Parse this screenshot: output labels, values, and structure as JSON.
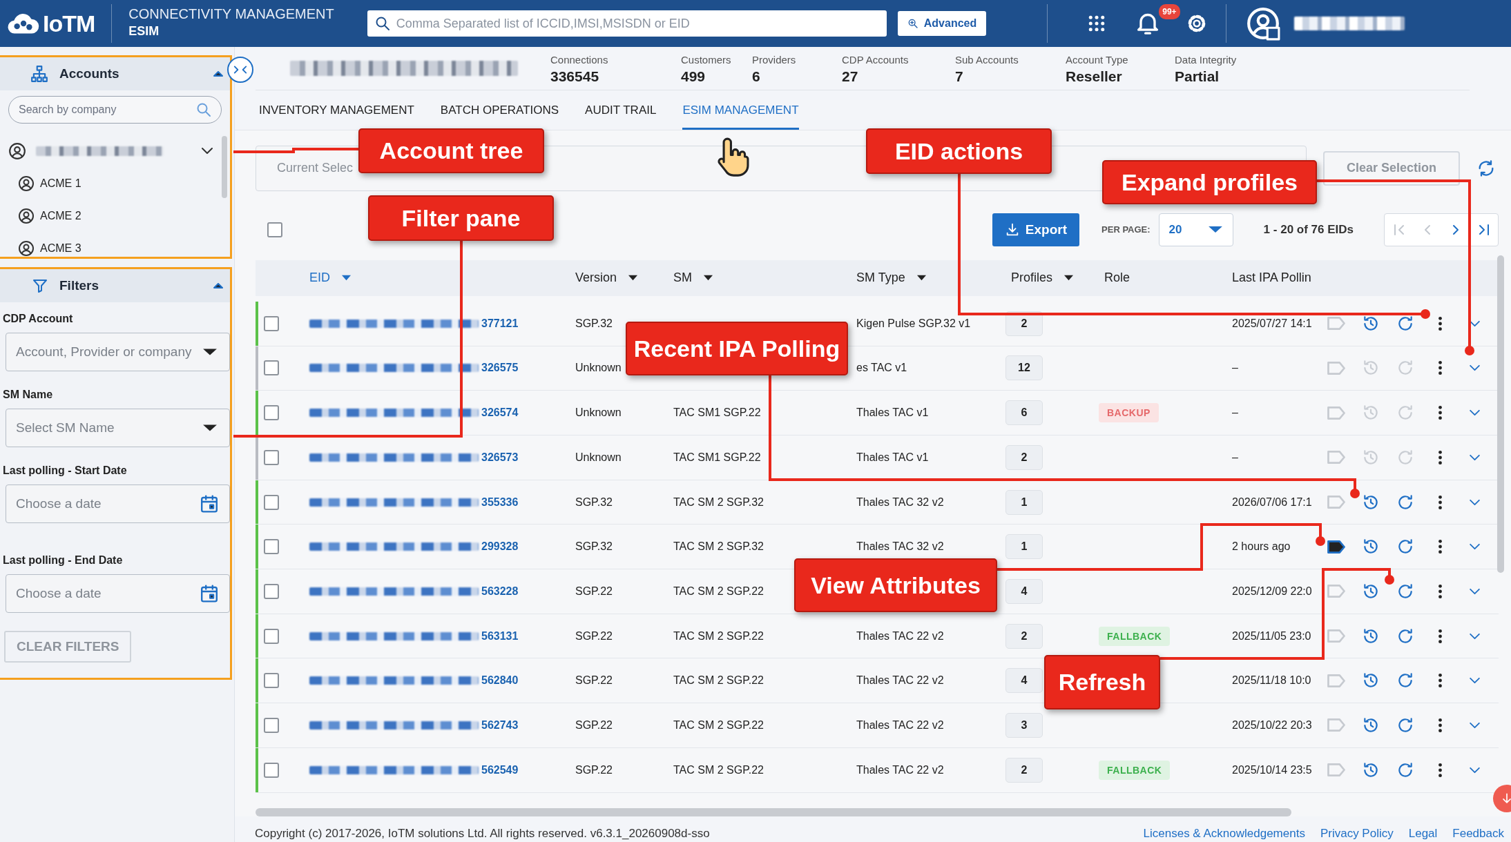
{
  "header": {
    "logo": "IoTM",
    "title": "CONNECTIVITY MANAGEMENT",
    "subtitle": "ESIM",
    "search": {
      "placeholder": "Comma Separated list of ICCID,IMSI,MSISDN or EID"
    },
    "advanced_button": "Advanced",
    "notifications_badge": "99+"
  },
  "sidebar": {
    "accounts": {
      "title": "Accounts",
      "expanded": true,
      "search": {
        "placeholder": "Search by company"
      },
      "root_expanded": true,
      "items": [
        {
          "label": "ACME 1"
        },
        {
          "label": "ACME 2"
        },
        {
          "label": "ACME 3"
        }
      ]
    },
    "filters": {
      "title": "Filters",
      "expanded": true,
      "fields": [
        {
          "label": "CDP Account",
          "placeholder": "Account, Provider or company",
          "kind": "select"
        },
        {
          "label": "SM Name",
          "placeholder": "Select SM Name",
          "kind": "select"
        },
        {
          "label": "Last polling - Start Date",
          "placeholder": "Choose a date",
          "kind": "date"
        },
        {
          "label": "Last polling - End Date",
          "placeholder": "Choose a date",
          "kind": "date"
        }
      ],
      "clear_button": {
        "label": "CLEAR FILTERS",
        "disabled": true
      }
    }
  },
  "stats": [
    {
      "label": "Connections",
      "value": "336545"
    },
    {
      "label": "Customers",
      "value": "499"
    },
    {
      "label": "Providers",
      "value": "6"
    },
    {
      "label": "CDP Accounts",
      "value": "27"
    },
    {
      "label": "Sub Accounts",
      "value": "7"
    },
    {
      "label": "Account Type",
      "value": "Reseller"
    },
    {
      "label": "Data Integrity",
      "value": "Partial"
    }
  ],
  "tabs": [
    {
      "label": "INVENTORY MANAGEMENT",
      "selected": false
    },
    {
      "label": "BATCH OPERATIONS",
      "selected": false
    },
    {
      "label": "AUDIT TRAIL",
      "selected": false
    },
    {
      "label": "ESIM MANAGEMENT",
      "selected": true
    }
  ],
  "selection": {
    "placeholder": "Current Selec",
    "clear_button": {
      "label": "Clear Selection",
      "disabled": true
    }
  },
  "toolbar": {
    "select_all_checked": false,
    "export_button": "Export",
    "per_page_label": "PER PAGE:",
    "per_page": "20",
    "range": "1 - 20 of 76 EIDs",
    "pager": [
      {
        "kind": "first",
        "disabled": true
      },
      {
        "kind": "prev",
        "disabled": true
      },
      {
        "kind": "next",
        "disabled": false
      },
      {
        "kind": "last",
        "disabled": false
      }
    ]
  },
  "table": {
    "columns": [
      {
        "label": "EID",
        "sortable": true,
        "sorted": true
      },
      {
        "label": "Version",
        "sortable": true,
        "sorted": false
      },
      {
        "label": "SM",
        "sortable": true,
        "sorted": false
      },
      {
        "label": "SM Type",
        "sortable": true,
        "sorted": false
      },
      {
        "label": "Profiles",
        "sortable": true,
        "sorted": false
      },
      {
        "label": "Role",
        "sortable": false,
        "sorted": false
      },
      {
        "label": "Last IPA Pollin",
        "sortable": false,
        "sorted": false
      }
    ],
    "rows": [
      {
        "eid": "377121",
        "checked": false,
        "version": "SGP.32",
        "sm_type": "Kigen Pulse SGP.32 v1",
        "profiles": "2",
        "last_ipa": "2025/07/27 14:1",
        "color": "#5cc24a",
        "attributes": false,
        "actions_enabled": true
      },
      {
        "eid": "326575",
        "checked": false,
        "version": "Unknown",
        "sm_type": "es TAC v1",
        "profiles": "12",
        "last_ipa": "–",
        "color": "#b9bcc2",
        "attributes": false,
        "actions_enabled": false
      },
      {
        "eid": "326574",
        "checked": false,
        "version": "Unknown",
        "sm": "TAC SM1 SGP.22",
        "sm_type": "Thales TAC v1",
        "profiles": "6",
        "role": {
          "kind": "backup",
          "label": "BACKUP"
        },
        "last_ipa": "–",
        "color": "#5cc24a",
        "attributes": false,
        "actions_enabled": false
      },
      {
        "eid": "326573",
        "checked": false,
        "version": "Unknown",
        "sm": "TAC SM1 SGP.22",
        "sm_type": "Thales TAC v1",
        "profiles": "2",
        "last_ipa": "–",
        "color": "#b9bcc2",
        "attributes": false,
        "actions_enabled": false
      },
      {
        "eid": "355336",
        "checked": false,
        "version": "SGP.32",
        "sm": "TAC SM 2 SGP.32",
        "sm_type": "Thales TAC 32 v2",
        "profiles": "1",
        "last_ipa": "2026/07/06 17:1",
        "color": "#5cc24a",
        "attributes": false,
        "actions_enabled": true
      },
      {
        "eid": "299328",
        "checked": false,
        "version": "SGP.32",
        "sm": "TAC SM 2 SGP.32",
        "sm_type": "Thales TAC 32 v2",
        "profiles": "1",
        "last_ipa": "2 hours ago",
        "color": "#5cc24a",
        "attributes": true,
        "actions_enabled": true
      },
      {
        "eid": "563228",
        "checked": false,
        "version": "SGP.22",
        "sm": "TAC SM 2 SGP.22",
        "profiles": "4",
        "last_ipa": "2025/12/09 22:0",
        "color": "#5cc24a",
        "attributes": false,
        "actions_enabled": true
      },
      {
        "eid": "563131",
        "checked": false,
        "version": "SGP.22",
        "sm": "TAC SM 2 SGP.22",
        "sm_type": "Thales TAC 22 v2",
        "profiles": "2",
        "role": {
          "kind": "fallback",
          "label": "FALLBACK"
        },
        "last_ipa": "2025/11/05 23:0",
        "color": "#5cc24a",
        "attributes": false,
        "actions_enabled": true
      },
      {
        "eid": "562840",
        "checked": false,
        "version": "SGP.22",
        "sm": "TAC SM 2 SGP.22",
        "sm_type": "Thales TAC 22 v2",
        "profiles": "4",
        "last_ipa": "2025/11/18 10:0",
        "color": "#5cc24a",
        "attributes": false,
        "actions_enabled": true
      },
      {
        "eid": "562743",
        "checked": false,
        "version": "SGP.22",
        "sm": "TAC SM 2 SGP.22",
        "sm_type": "Thales TAC 22 v2",
        "profiles": "3",
        "last_ipa": "2025/10/22 20:3",
        "color": "#5cc24a",
        "attributes": false,
        "actions_enabled": true
      },
      {
        "eid": "562549",
        "checked": false,
        "version": "SGP.22",
        "sm": "TAC SM 2 SGP.22",
        "sm_type": "Thales TAC 22 v2",
        "profiles": "2",
        "role": {
          "kind": "fallback",
          "label": "FALLBACK"
        },
        "last_ipa": "2025/10/14 23:5",
        "color": "#5cc24a",
        "attributes": false,
        "actions_enabled": true
      }
    ]
  },
  "footer": {
    "copyright": "Copyright (c) 2017-2026, IoTM solutions Ltd. All rights reserved. v6.3.1_20260908d-sso",
    "links": [
      "Licenses & Acknowledgements",
      "Privacy Policy",
      "Legal",
      "Feedback"
    ]
  },
  "callouts": [
    {
      "text": "Account tree"
    },
    {
      "text": "Filter pane"
    },
    {
      "text": "EID actions"
    },
    {
      "text": "Expand profiles"
    },
    {
      "text": "Recent IPA Polling"
    },
    {
      "text": "View Attributes"
    },
    {
      "text": "Refresh"
    }
  ]
}
